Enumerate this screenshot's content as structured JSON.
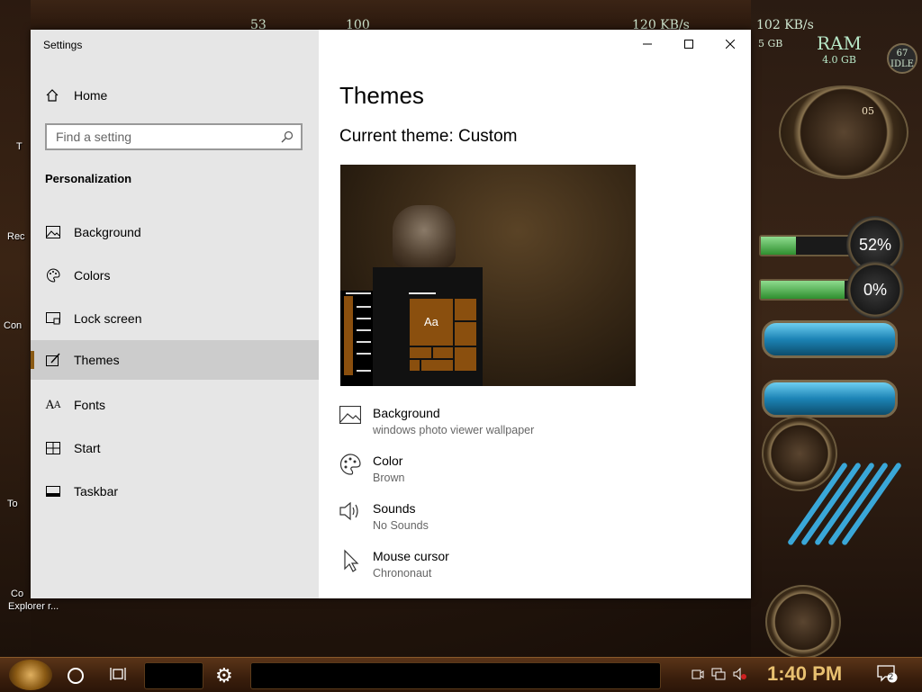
{
  "desktop": {
    "left_labels": [
      "T",
      "Rec",
      "Con",
      "To",
      "Co",
      "Explorer r..."
    ],
    "top_readouts": [
      "53",
      "100",
      "120 KB/s",
      "102 KB/s",
      "5 GB"
    ],
    "ram": {
      "label": "RAM",
      "value": "4.0 GB"
    },
    "idle_readout": {
      "value": "67",
      "label": "IDLE"
    },
    "gauges": [
      "52%",
      "0%"
    ],
    "clock_numeral": "05",
    "colors": {
      "wood_dark": "#24160d",
      "green_fill": "#2f8f2f",
      "tube_blue": "#1c83b5"
    }
  },
  "window": {
    "title": "Settings",
    "controls": {
      "minimize_icon": "minimize-icon",
      "maximize_icon": "maximize-icon",
      "close_icon": "close-icon"
    }
  },
  "nav": {
    "home_label": "Home",
    "search_placeholder": "Find a setting",
    "section_title": "Personalization",
    "items": [
      {
        "label": "Background",
        "icon": "image-icon"
      },
      {
        "label": "Colors",
        "icon": "palette-icon"
      },
      {
        "label": "Lock screen",
        "icon": "lock-screen-icon"
      },
      {
        "label": "Themes",
        "icon": "brush-icon",
        "active": true
      },
      {
        "label": "Fonts",
        "icon": "fonts-icon"
      },
      {
        "label": "Start",
        "icon": "start-icon"
      },
      {
        "label": "Taskbar",
        "icon": "taskbar-icon"
      }
    ]
  },
  "main": {
    "title": "Themes",
    "current_theme": "Current theme: Custom",
    "preview_tile_text": "Aa",
    "accent_color": "#8a4f0e",
    "properties": [
      {
        "label": "Background",
        "value": "windows photo viewer wallpaper",
        "icon": "image-icon"
      },
      {
        "label": "Color",
        "value": "Brown",
        "icon": "palette-icon"
      },
      {
        "label": "Sounds",
        "value": "No Sounds",
        "icon": "speaker-icon"
      },
      {
        "label": "Mouse cursor",
        "value": "Chrononaut",
        "icon": "cursor-icon"
      }
    ]
  },
  "taskbar": {
    "clock": "1:40 PM",
    "notification_count": "2"
  }
}
